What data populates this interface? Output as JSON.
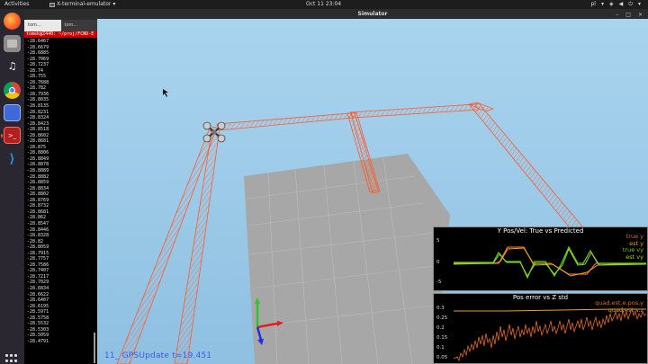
{
  "topbar": {
    "activities": "Activities",
    "app_name": "X-terminal-emulator",
    "clock": "Oct 11  23:04",
    "lang": "pl"
  },
  "dock": {
    "items": [
      {
        "icon": "firefox-icon"
      },
      {
        "icon": "files-icon"
      },
      {
        "icon": "rhythmbox-icon"
      },
      {
        "icon": "chromium-icon"
      },
      {
        "icon": "screenshot-icon"
      },
      {
        "icon": "terminal-icon"
      },
      {
        "icon": "vscode-icon"
      }
    ]
  },
  "terminal": {
    "tabs": [
      "tom...",
      "tom..."
    ],
    "prompt": "tomek@Z440: ~/proj/FCND-E",
    "lines": [
      "-28.6467",
      "-28.6679",
      "-28.6885",
      "-28.7069",
      "-28.7237",
      "-28.74",
      "-28.755",
      "-28.7688",
      "-28.782",
      "-28.7936",
      "-28.8035",
      "-28.8135",
      "-28.8231",
      "-28.8324",
      "-28.8423",
      "-28.8518",
      "-28.8602",
      "-28.8681",
      "-28.875",
      "-28.8806",
      "-28.8849",
      "-28.8878",
      "-28.8889",
      "-28.8882",
      "-28.8859",
      "-28.8834",
      "-28.8802",
      "-28.8769",
      "-28.8732",
      "-28.8681",
      "-28.862",
      "-28.8547",
      "-28.8446",
      "-28.8328",
      "-28.82",
      "-28.8059",
      "-28.7915",
      "-28.7757",
      "-28.7586",
      "-28.7407",
      "-28.7217",
      "-28.7029",
      "-28.6834",
      "-28.6622",
      "-28.6407",
      "-28.6195",
      "-28.5971",
      "-28.5758",
      "-28.5532",
      "-28.5303",
      "-28.5059",
      "-28.4791"
    ]
  },
  "simulator": {
    "title": "Simulator",
    "status": "11_ GPSUpdate   t=19.451"
  },
  "plot1": {
    "title": "Y Pos/Vel: True vs Predicted",
    "legend": [
      {
        "label": "true y",
        "color": "#e36b1e"
      },
      {
        "label": "est y",
        "color": "#e8a21e"
      },
      {
        "label": "true vy",
        "color": "#5fd21e"
      },
      {
        "label": "est vy",
        "color": "#9ad51e"
      }
    ],
    "ticks": [
      "5",
      "0",
      "-5"
    ]
  },
  "plot2": {
    "title": "Pos error vs Z std",
    "legend": [
      {
        "label": "quad.est.e.pos.y",
        "color": "#e36b1e"
      },
      {
        "label": "quad.est.s.z",
        "color": "#e8a21e"
      }
    ],
    "ticks": [
      "0.3",
      "0.25",
      "0.2",
      "0.15",
      "0.1",
      "0.05"
    ]
  },
  "colors": {
    "accent": "#e95420",
    "sky": "#a9d4ee",
    "track": "#ff5a2a",
    "status_text": "#3a5be0"
  }
}
